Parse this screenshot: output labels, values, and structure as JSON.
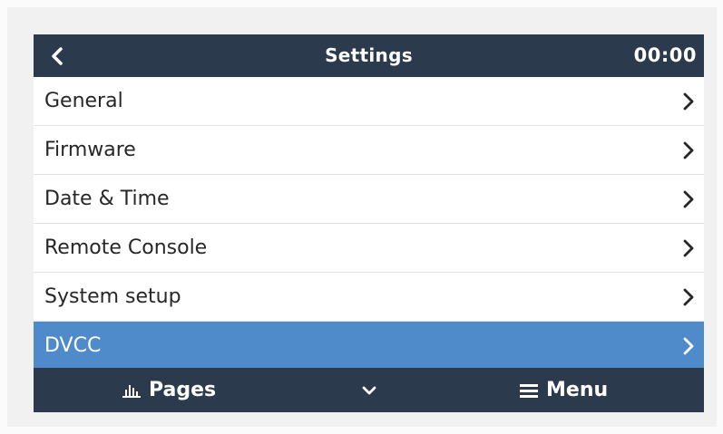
{
  "header": {
    "title": "Settings",
    "clock": "00:00",
    "back_icon": "chevron-left-icon"
  },
  "menu_items": [
    {
      "label": "General",
      "icon": "chevron-right-icon"
    },
    {
      "label": "Firmware",
      "icon": "chevron-right-icon"
    },
    {
      "label": "Date & Time",
      "icon": "chevron-right-icon"
    },
    {
      "label": "Remote Console",
      "icon": "chevron-right-icon"
    },
    {
      "label": "System setup",
      "icon": "chevron-right-icon"
    },
    {
      "label": "DVCC",
      "icon": "chevron-right-icon",
      "selected": true
    }
  ],
  "footer": {
    "pages_label": "Pages",
    "pages_icon": "bar-chart-icon",
    "down_icon": "chevron-down-icon",
    "menu_label": "Menu",
    "menu_icon": "hamburger-icon"
  },
  "colors": {
    "header_bg": "#2b3a4c",
    "selected_bg": "#4f8bcb",
    "text": "#272727"
  }
}
